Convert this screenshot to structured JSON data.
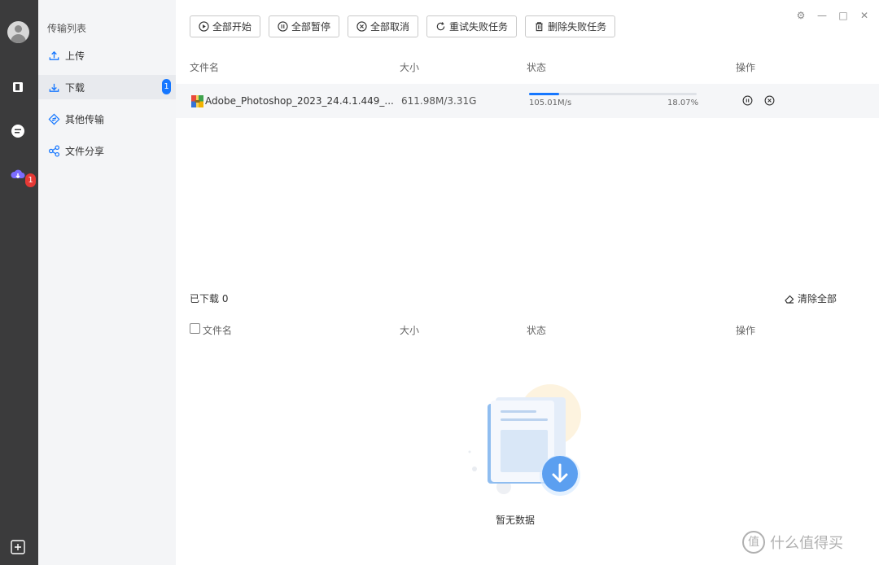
{
  "rail": {
    "icons": [
      "avatar",
      "office-icon",
      "chat-icon",
      "cloud-transfer-icon",
      "add-app-icon"
    ],
    "badge": "1"
  },
  "sidebar": {
    "heading": "传输列表",
    "items": [
      {
        "label": "上传",
        "icon": "upload-icon"
      },
      {
        "label": "下载",
        "icon": "download-icon",
        "count": "1"
      },
      {
        "label": "其他传输",
        "icon": "transfer-icon"
      },
      {
        "label": "文件分享",
        "icon": "share-icon"
      }
    ]
  },
  "toolbar": {
    "start_all": "全部开始",
    "pause_all": "全部暂停",
    "cancel_all": "全部取消",
    "retry_failed": "重试失败任务",
    "delete_failed": "删除失败任务"
  },
  "window_controls": [
    "settings-icon",
    "minimize-icon",
    "maximize-icon",
    "close-icon"
  ],
  "active_table": {
    "columns": [
      "文件名",
      "大小",
      "状态",
      "操作"
    ],
    "rows": [
      {
        "name": "Adobe_Photoshop_2023_24.4.1.449_...",
        "size": "611.98M/3.31G",
        "speed": "105.01M/s",
        "percent": "18.07%",
        "progress": 0.1807
      }
    ]
  },
  "downloaded": {
    "title": "已下载 0",
    "clear_all": "清除全部",
    "columns": [
      "文件名",
      "大小",
      "状态",
      "操作"
    ],
    "empty_text": "暂无数据"
  },
  "watermark": "什么值得买",
  "colors": {
    "accent": "#1677ff",
    "rail_bg": "#3b3b3c",
    "sidebar_bg": "#f4f5f7",
    "badge_red": "#e53935"
  }
}
